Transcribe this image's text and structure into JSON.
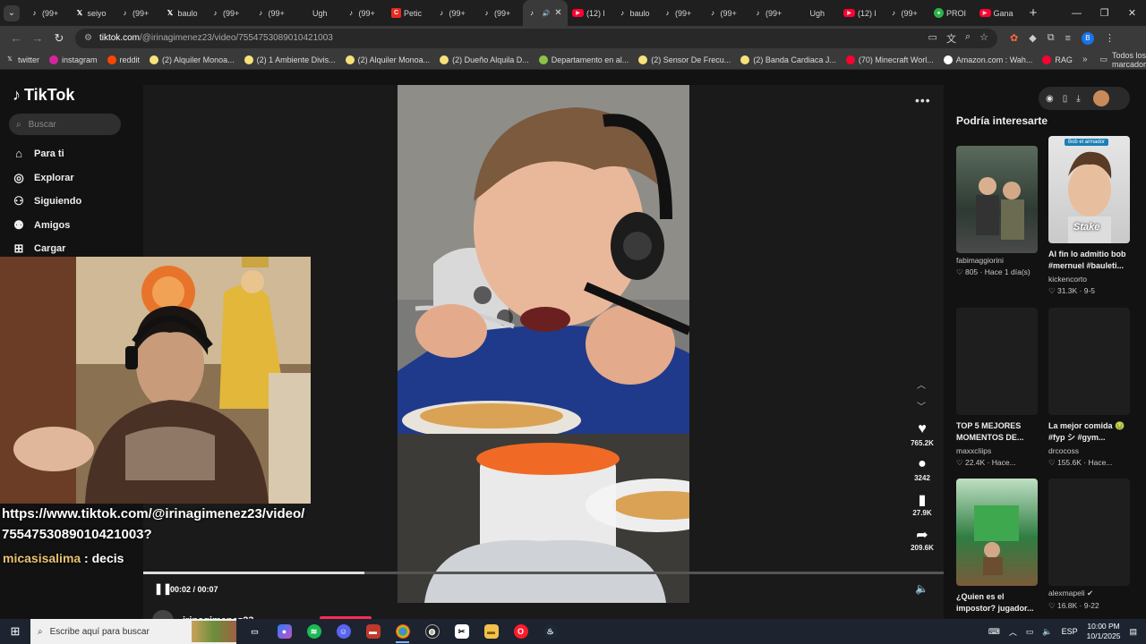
{
  "browser": {
    "tabs": [
      {
        "icon": "tiktok",
        "label": "(99+"
      },
      {
        "icon": "x",
        "label": "seiyo"
      },
      {
        "icon": "tiktok",
        "label": "(99+"
      },
      {
        "icon": "x",
        "label": "baulo"
      },
      {
        "icon": "tiktok",
        "label": "(99+"
      },
      {
        "icon": "tiktok",
        "label": "(99+"
      },
      {
        "icon": "none",
        "label": "Ugh"
      },
      {
        "icon": "tiktok",
        "label": "(99+"
      },
      {
        "icon": "change",
        "label": "Petic"
      },
      {
        "icon": "tiktok",
        "label": "(99+"
      },
      {
        "icon": "tiktok",
        "label": "(99+"
      },
      {
        "icon": "tiktok",
        "label": "",
        "active": true
      },
      {
        "icon": "yt",
        "label": "(12) l"
      },
      {
        "icon": "tiktok",
        "label": "baulo"
      },
      {
        "icon": "tiktok",
        "label": "(99+"
      },
      {
        "icon": "tiktok",
        "label": "(99+"
      },
      {
        "icon": "tiktok",
        "label": "(99+"
      },
      {
        "icon": "none",
        "label": "Ugh"
      },
      {
        "icon": "yt",
        "label": "(12) l"
      },
      {
        "icon": "tiktok",
        "label": "(99+"
      },
      {
        "icon": "green",
        "label": "PROI"
      },
      {
        "icon": "yt",
        "label": "Gana"
      }
    ],
    "url_domain": "tiktok.com",
    "url_path": "/@irinagimenez23/video/7554753089010421003",
    "bookmarks": [
      {
        "label": "twitter",
        "color": "#000000",
        "icon": "x"
      },
      {
        "label": "instagram",
        "color": "#d6249f"
      },
      {
        "label": "reddit",
        "color": "#ff4500"
      },
      {
        "label": "(2) Alquiler Monoa...",
        "color": "#f6e27a"
      },
      {
        "label": "(2) 1 Ambiente Divis...",
        "color": "#f6e27a"
      },
      {
        "label": "(2) Alquiler Monoa...",
        "color": "#f6e27a"
      },
      {
        "label": "(2) Dueño Alquila D...",
        "color": "#f6e27a"
      },
      {
        "label": "Departamento en al...",
        "color": "#8bc34a"
      },
      {
        "label": "(2) Sensor De Frecu...",
        "color": "#f6e27a"
      },
      {
        "label": "(2) Banda Cardiaca J...",
        "color": "#f6e27a"
      },
      {
        "label": "(70) Minecraft Worl...",
        "color": "#ff0033"
      },
      {
        "label": "Amazon.com : Wah...",
        "color": "#ffffff"
      },
      {
        "label": "RAG",
        "color": "#ff0033"
      }
    ],
    "all_bookmarks": "Todos los marcadores"
  },
  "tiktok": {
    "logo": "TikTok",
    "search_placeholder": "Buscar",
    "nav": [
      {
        "label": "Para ti",
        "icon": "home-icon",
        "glyph": "⌂"
      },
      {
        "label": "Explorar",
        "icon": "compass-icon",
        "glyph": "◎"
      },
      {
        "label": "Siguiendo",
        "icon": "following-icon",
        "glyph": "⚇"
      },
      {
        "label": "Amigos",
        "icon": "friends-icon",
        "glyph": "⚉"
      },
      {
        "label": "Cargar",
        "icon": "upload-icon",
        "glyph": "⊞"
      }
    ],
    "video": {
      "likes": "765.2K",
      "comments": "3242",
      "saves": "27.9K",
      "shares": "209.6K",
      "time": "00:02 / 00:07",
      "progress": 0.276,
      "author": "irinagimenez23"
    },
    "recommendations_title": "Podría interesarte",
    "recommendations": [
      {
        "title": "",
        "user": "fabimaggiorini",
        "meta": "♡ 805 · Hace 1 día(s)",
        "thumb": "gym"
      },
      {
        "title": "Al fin lo admitio bob #mernuel #bauleti...",
        "user": "kickencorto",
        "meta": "♡ 31.3K · 9-5",
        "thumb": "face",
        "tag": "Bob el armador",
        "sticker": "Stake"
      },
      {
        "title": "TOP 5 MEJORES MOMENTOS DE...",
        "user": "maxxcliips",
        "meta": "♡ 22.4K · Hace...",
        "thumb": "blank"
      },
      {
        "title": "La mejor comida 🤢 #fyp シ #gym...",
        "user": "drcocoss",
        "meta": "♡ 155.6K · Hace...",
        "thumb": "blank"
      },
      {
        "title": "¿Quien es el impostor? jugador...",
        "user": "",
        "meta": "",
        "thumb": "green"
      },
      {
        "title": "",
        "user": "alexmapeli ✔",
        "meta": "♡ 16.8K · 9-22",
        "thumb": "blank"
      }
    ]
  },
  "overlay": {
    "url_line1": "https://www.tiktok.com/@irinagimenez23/video/",
    "url_line2": "7554753089010421003?",
    "chat_user": "micasisalima",
    "chat_msg": " : decis"
  },
  "taskbar": {
    "search_placeholder": "Escribe aquí para buscar",
    "language": "ESP",
    "time": "10:00 PM",
    "date": "10/1/2025"
  }
}
